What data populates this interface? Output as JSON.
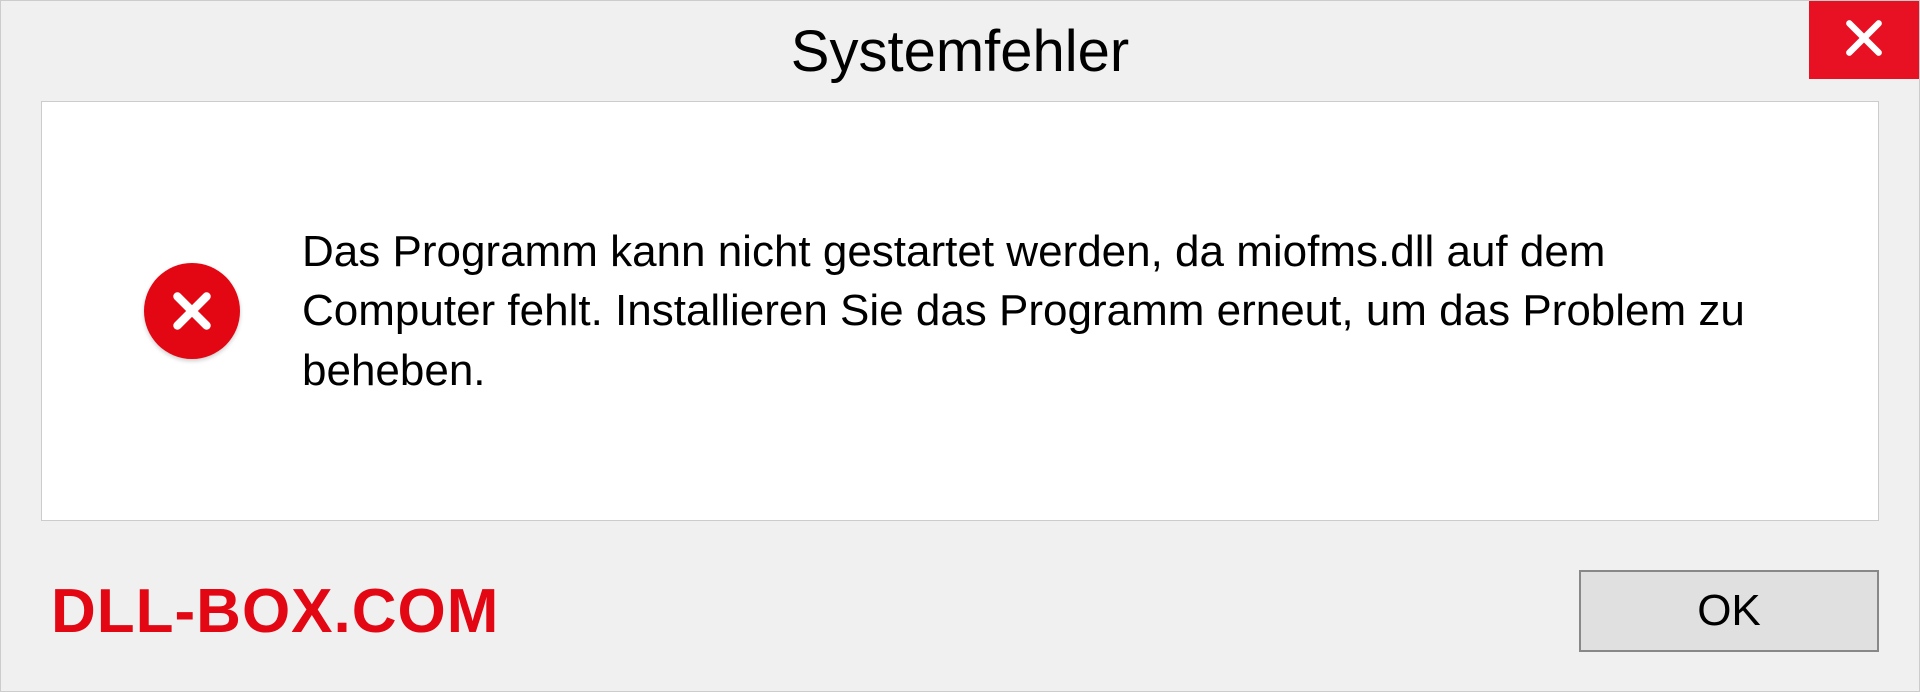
{
  "dialog": {
    "title": "Systemfehler",
    "message": "Das Programm kann nicht gestartet werden, da miofms.dll auf dem Computer fehlt. Installieren Sie das Programm erneut, um das Problem zu beheben.",
    "ok_label": "OK"
  },
  "watermark": "DLL-BOX.COM"
}
